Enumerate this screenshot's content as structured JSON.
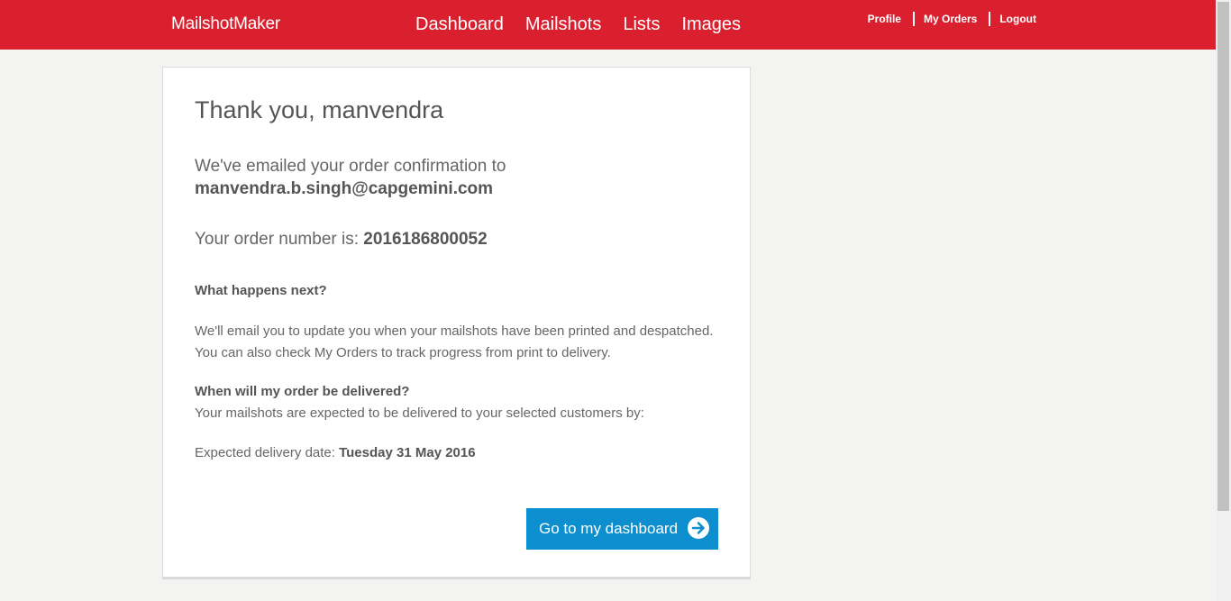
{
  "header": {
    "brand_bold": "Mailshot",
    "brand_rest": "Maker",
    "nav": [
      "Dashboard",
      "Mailshots",
      "Lists",
      "Images"
    ],
    "user_links": [
      "Profile",
      "My Orders",
      "Logout"
    ]
  },
  "confirmation": {
    "title": "Thank you, manvendra",
    "emailed_text": "We've emailed your order confirmation to",
    "email": "manvendra.b.singh@capgemini.com",
    "order_label": "Your order number is: ",
    "order_number": "2016186800052",
    "next_heading": "What happens next?",
    "next_line1": "We'll email you to update you when your mailshots have been printed and despatched.",
    "next_line2": "You can also check My Orders to track progress from print to delivery.",
    "delivery_heading": "When will my order be delivered?",
    "delivery_text": "Your mailshots are expected to be delivered to your selected customers by:",
    "delivery_label": "Expected delivery date: ",
    "delivery_date": "Tuesday 31 May 2016",
    "button_label": "Go to my dashboard",
    "button_icon": "arrow-right-circle-icon"
  },
  "colors": {
    "header_red": "#da202f",
    "button_blue": "#0d8ecf",
    "background": "#f3f3f2"
  }
}
